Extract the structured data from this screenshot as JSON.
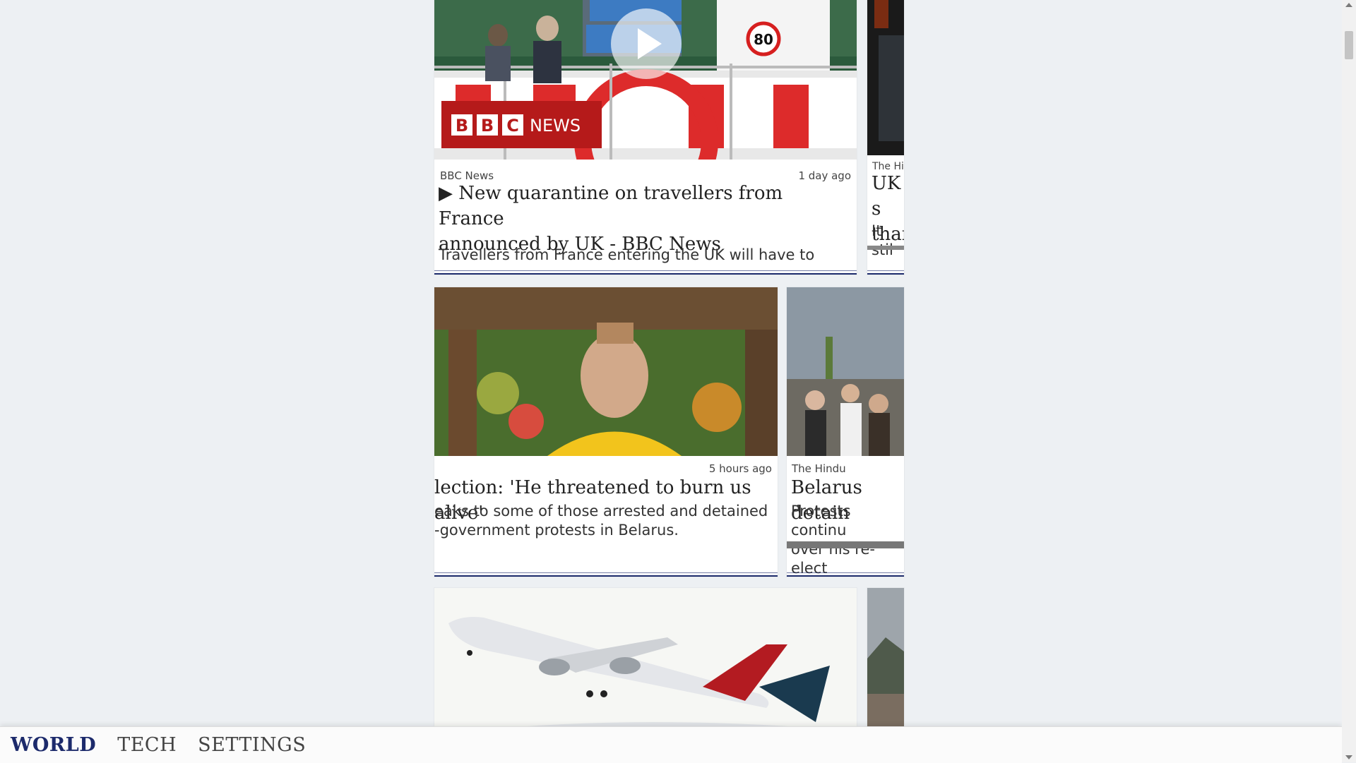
{
  "cards": [
    {
      "source": "BBC News",
      "time": "1 day ago",
      "headline_line1": "▶ New quarantine on travellers from France",
      "headline_line2": "announced by UK - BBC News",
      "snippet": "Travellers from France entering the UK will have to",
      "logo_text": "BBC NEWS",
      "sign_number": "80"
    },
    {
      "source_partial": "The Hi",
      "headline_partial_1": "UK s",
      "headline_partial_2": "than",
      "snippet_partial": "It stil"
    },
    {
      "time": "5 hours ago",
      "headline": "lection: 'He threatened to burn us alive'",
      "snippet_line1": "eaks to some of those arrested and detained",
      "snippet_line2": "-government protests in Belarus."
    },
    {
      "source": "The Hindu",
      "headline": "Belarus detain",
      "snippet_line1": "Protests continu",
      "snippet_line2": "over his re-elect"
    }
  ],
  "nav": {
    "world": "WORLD",
    "tech": "TECH",
    "settings": "SETTINGS"
  },
  "colors": {
    "accent": "#1c2a6b",
    "background": "#edf0f3"
  }
}
